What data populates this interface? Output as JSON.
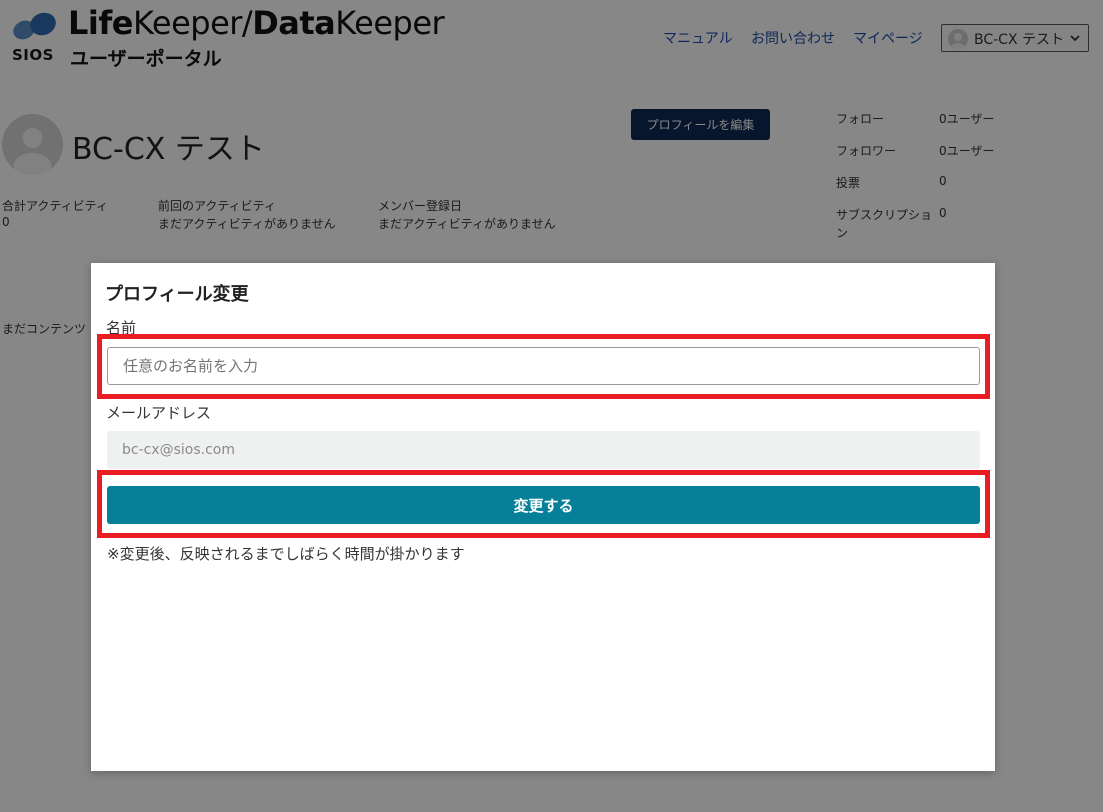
{
  "header": {
    "logo_brand": "SIOS",
    "logo_title_part1": "Life",
    "logo_title_part2": "Keeper/",
    "logo_title_part3": "Data",
    "logo_title_part4": "Keeper",
    "logo_subtitle": "ユーザーポータル",
    "nav": [
      "マニュアル",
      "お問い合わせ",
      "マイページ"
    ],
    "user_menu_label": "BC-CX テスト"
  },
  "profile": {
    "name": "BC-CX テスト",
    "edit_button": "プロフィールを編集",
    "stats": [
      {
        "label": "合計アクティビティ",
        "value": "0"
      },
      {
        "label": "前回のアクティビティ",
        "value": "まだアクティビティがありません"
      },
      {
        "label": "メンバー登録日",
        "value": "まだアクティビティがありません"
      }
    ],
    "side_stats": [
      {
        "label": "フォロー",
        "value": "0ユーザー"
      },
      {
        "label": "フォロワー",
        "value": "0ユーザー"
      },
      {
        "label": "投票",
        "value": "0"
      },
      {
        "label": "サブスクリプション",
        "value": "0"
      }
    ],
    "empty_content": "まだコンテンツ"
  },
  "modal": {
    "title": "プロフィール変更",
    "name_label": "名前",
    "name_placeholder": "任意のお名前を入力",
    "email_label": "メールアドレス",
    "email_value": "bc-cx@sios.com",
    "submit_label": "変更する",
    "note": "※変更後、反映されるまでしばらく時間が掛かります"
  },
  "colors": {
    "highlight": "#ea1c24",
    "submit": "#067f99",
    "edit_button": "#0e2a55",
    "nav_link": "#1f4fa8"
  }
}
